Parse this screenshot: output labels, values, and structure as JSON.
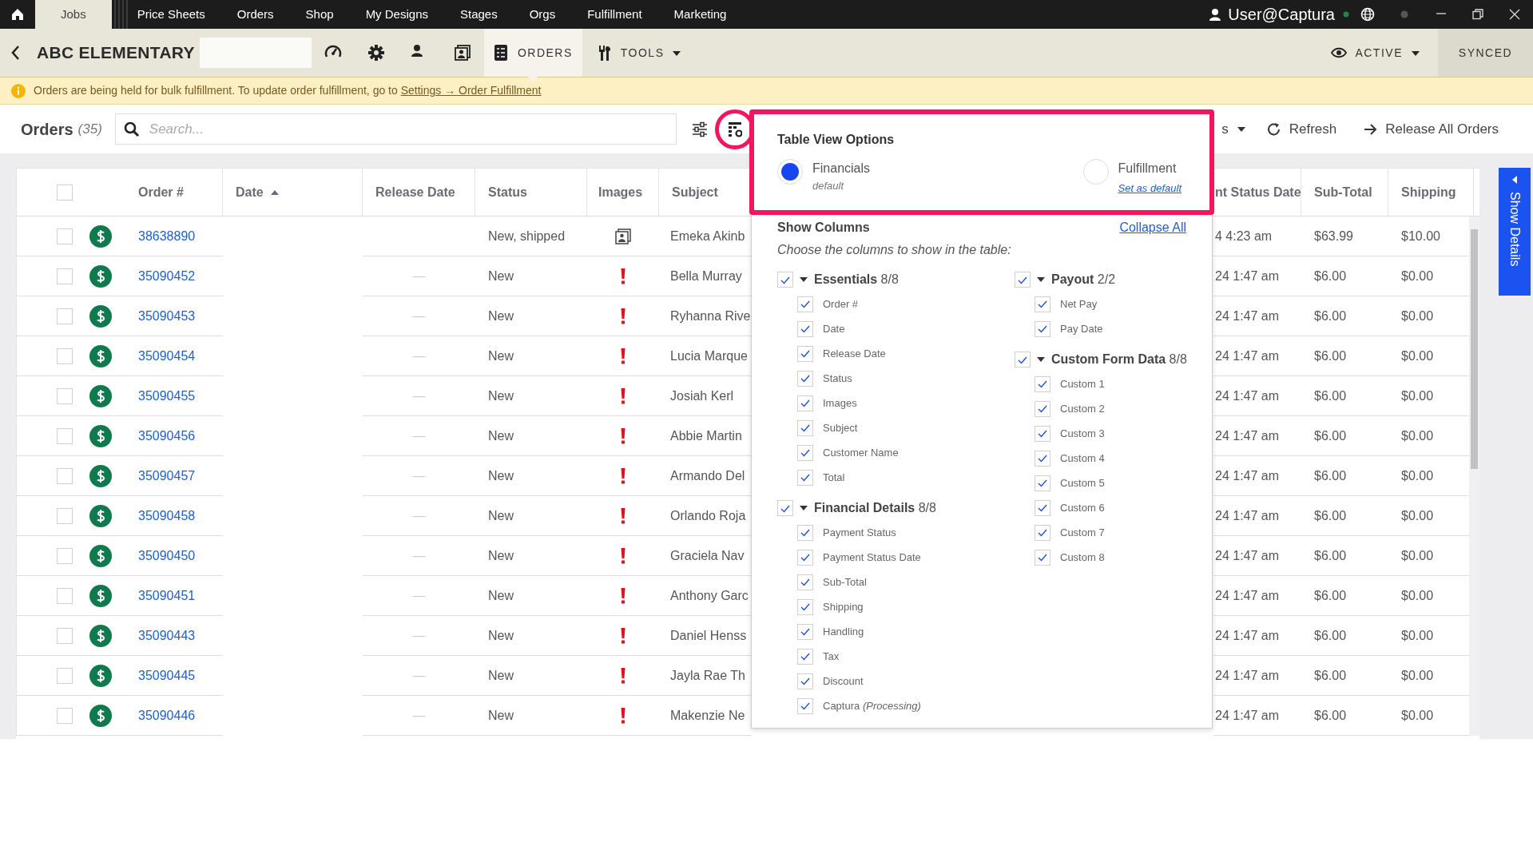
{
  "top_nav": {
    "items": [
      {
        "label": "Jobs",
        "selected": true
      },
      {
        "label": "Price Sheets",
        "selected": false
      },
      {
        "label": "Orders",
        "selected": false
      },
      {
        "label": "Shop",
        "selected": false
      },
      {
        "label": "My Designs",
        "selected": false
      },
      {
        "label": "Stages",
        "selected": false
      },
      {
        "label": "Orgs",
        "selected": false
      },
      {
        "label": "Fulfillment",
        "selected": false
      },
      {
        "label": "Marketing",
        "selected": false
      }
    ],
    "user": "User@Captura"
  },
  "header": {
    "title": "ABC ELEMENTARY",
    "tabs": [
      {
        "label": "ORDERS",
        "kind": "orders",
        "selected": true
      },
      {
        "label": "TOOLS",
        "kind": "tools",
        "selected": false
      }
    ],
    "status": "ACTIVE",
    "sync": "SYNCED"
  },
  "alert": {
    "text": "Orders are being held for bulk fulfillment. To update order fulfillment, go to",
    "link": "Settings → Order Fulfillment"
  },
  "toolbar": {
    "title": "Orders",
    "count": "(35)",
    "search": {
      "placeholder": "Search..."
    },
    "buttons": [
      {
        "label": "s",
        "kind": "dropdown"
      },
      {
        "label": "Refresh",
        "kind": "refresh"
      },
      {
        "label": "Release All Orders",
        "kind": "release"
      }
    ]
  },
  "table": {
    "select_all": {
      "checked": false
    },
    "columns": [
      {
        "label": "Order #"
      },
      {
        "label": "Date",
        "sorted": true
      },
      {
        "label": "Release Date"
      },
      {
        "label": "Status"
      },
      {
        "label": "Images"
      },
      {
        "label": "Subject"
      },
      {
        "label": "nt Status Date"
      },
      {
        "label": "Sub-Total"
      },
      {
        "label": "Shipping"
      }
    ],
    "rows": [
      {
        "checked": false,
        "order": "38638890",
        "status": "New, shipped",
        "kind": "photo",
        "subject": "Emeka Akinb",
        "payment_status_date": "4 4:23 am",
        "subtotal": "$63.99",
        "shipping": "$10.00"
      },
      {
        "checked": false,
        "order": "35090452",
        "release_date": "—",
        "status": "New",
        "kind": "alert",
        "subject": "Bella Murray",
        "payment_status_date": "24 1:47 am",
        "subtotal": "$6.00",
        "shipping": "$0.00"
      },
      {
        "checked": false,
        "order": "35090453",
        "release_date": "—",
        "status": "New",
        "kind": "alert",
        "subject": "Ryhanna Rive",
        "payment_status_date": "24 1:47 am",
        "subtotal": "$6.00",
        "shipping": "$0.00"
      },
      {
        "checked": false,
        "order": "35090454",
        "release_date": "—",
        "status": "New",
        "kind": "alert",
        "subject": "Lucia Marque",
        "payment_status_date": "24 1:47 am",
        "subtotal": "$6.00",
        "shipping": "$0.00"
      },
      {
        "checked": false,
        "order": "35090455",
        "release_date": "—",
        "status": "New",
        "kind": "alert",
        "subject": "Josiah Kerl",
        "payment_status_date": "24 1:47 am",
        "subtotal": "$6.00",
        "shipping": "$0.00"
      },
      {
        "checked": false,
        "order": "35090456",
        "release_date": "—",
        "status": "New",
        "kind": "alert",
        "subject": "Abbie Martin",
        "payment_status_date": "24 1:47 am",
        "subtotal": "$6.00",
        "shipping": "$0.00"
      },
      {
        "checked": false,
        "order": "35090457",
        "release_date": "—",
        "status": "New",
        "kind": "alert",
        "subject": "Armando Del",
        "payment_status_date": "24 1:47 am",
        "subtotal": "$6.00",
        "shipping": "$0.00"
      },
      {
        "checked": false,
        "order": "35090458",
        "release_date": "—",
        "status": "New",
        "kind": "alert",
        "subject": "Orlando Roja",
        "payment_status_date": "24 1:47 am",
        "subtotal": "$6.00",
        "shipping": "$0.00"
      },
      {
        "checked": false,
        "order": "35090450",
        "release_date": "—",
        "status": "New",
        "kind": "alert",
        "subject": "Graciela Nav",
        "payment_status_date": "24 1:47 am",
        "subtotal": "$6.00",
        "shipping": "$0.00"
      },
      {
        "checked": false,
        "order": "35090451",
        "release_date": "—",
        "status": "New",
        "kind": "alert",
        "subject": "Anthony Garc",
        "payment_status_date": "24 1:47 am",
        "subtotal": "$6.00",
        "shipping": "$0.00"
      },
      {
        "checked": false,
        "order": "35090443",
        "release_date": "—",
        "status": "New",
        "kind": "alert",
        "subject": "Daniel Henss",
        "payment_status_date": "24 1:47 am",
        "subtotal": "$6.00",
        "shipping": "$0.00"
      },
      {
        "checked": false,
        "order": "35090445",
        "release_date": "—",
        "status": "New",
        "kind": "alert",
        "subject": "Jayla Rae Th",
        "payment_status_date": "24 1:47 am",
        "subtotal": "$6.00",
        "shipping": "$0.00"
      },
      {
        "checked": false,
        "order": "35090446",
        "release_date": "—",
        "status": "New",
        "kind": "alert",
        "subject": "Makenzie Ne",
        "payment_status_date": "24 1:47 am",
        "subtotal": "$6.00",
        "shipping": "$0.00"
      }
    ]
  },
  "popup": {
    "title": "Table View Options",
    "views": [
      {
        "label": "Financials",
        "note": "default",
        "selected": true
      },
      {
        "label": "Fulfillment",
        "link": "Set as default",
        "selected": false
      }
    ],
    "section_title": "Show Columns",
    "collapse_link": "Collapse All",
    "hint": "Choose the columns to show in the table:",
    "column_groups": [
      {
        "groups": [
          {
            "label": "Essentials",
            "count": "8/8",
            "checked": true,
            "expanded": true,
            "children": [
              {
                "label": "Order #",
                "checked": true
              },
              {
                "label": "Date",
                "checked": true
              },
              {
                "label": "Release Date",
                "checked": true
              },
              {
                "label": "Status",
                "checked": true
              },
              {
                "label": "Images",
                "checked": true
              },
              {
                "label": "Subject",
                "checked": true
              },
              {
                "label": "Customer Name",
                "checked": true
              },
              {
                "label": "Total",
                "checked": true
              }
            ]
          },
          {
            "label": "Financial Details",
            "count": "8/8",
            "checked": true,
            "expanded": true,
            "children": [
              {
                "label": "Payment Status",
                "checked": true
              },
              {
                "label": "Payment Status Date",
                "checked": true
              },
              {
                "label": "Sub-Total",
                "checked": true
              },
              {
                "label": "Shipping",
                "checked": true
              },
              {
                "label": "Handling",
                "checked": true
              },
              {
                "label": "Tax",
                "checked": true
              },
              {
                "label": "Discount",
                "checked": true
              },
              {
                "label": "Captura *(Processing)*",
                "checked": true
              }
            ]
          }
        ]
      },
      {
        "groups": [
          {
            "label": "Payout",
            "count": "2/2",
            "checked": true,
            "expanded": true,
            "children": [
              {
                "label": "Net Pay",
                "checked": true
              },
              {
                "label": "Pay Date",
                "checked": true
              }
            ]
          },
          {
            "label": "Custom Form Data",
            "count": "8/8",
            "checked": true,
            "expanded": true,
            "children": [
              {
                "label": "Custom 1",
                "checked": true
              },
              {
                "label": "Custom 2",
                "checked": true
              },
              {
                "label": "Custom 3",
                "checked": true
              },
              {
                "label": "Custom 4",
                "checked": true
              },
              {
                "label": "Custom 5",
                "checked": true
              },
              {
                "label": "Custom 6",
                "checked": true
              },
              {
                "label": "Custom 7",
                "checked": true
              },
              {
                "label": "Custom 8",
                "checked": true
              }
            ]
          }
        ]
      }
    ]
  },
  "side_tab": {
    "label": "Show Details"
  }
}
